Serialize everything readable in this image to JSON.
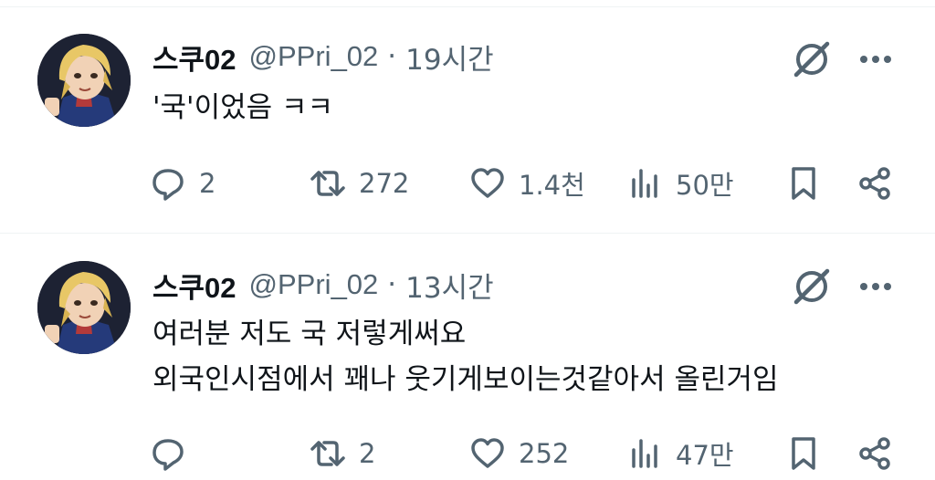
{
  "tweets": [
    {
      "name": "스쿠02",
      "handle": "@PPri_02",
      "separator": "·",
      "time": "19시간",
      "text_lines": [
        "'국'이었음 ㅋㅋ"
      ],
      "replies": "2",
      "reposts": "272",
      "likes": "1.4천",
      "views": "50만"
    },
    {
      "name": "스쿠02",
      "handle": "@PPri_02",
      "separator": "·",
      "time": "13시간",
      "text_lines": [
        "여러분 저도 국 저렇게써요",
        "외국인시점에서 꽤나 웃기게보이는것같아서 올린거임"
      ],
      "replies": "",
      "reposts": "2",
      "likes": "252",
      "views": "47만"
    }
  ],
  "icons": {
    "reply": "reply-bubble-icon",
    "repost": "repost-arrows-icon",
    "like": "heart-icon",
    "views": "analytics-bars-icon",
    "bookmark": "bookmark-icon",
    "share": "share-icon",
    "grok": "grok-slash-icon",
    "more": "more-dots-icon"
  },
  "colors": {
    "text": "#0f1419",
    "secondary": "#536471",
    "divider": "#eff3f4"
  }
}
